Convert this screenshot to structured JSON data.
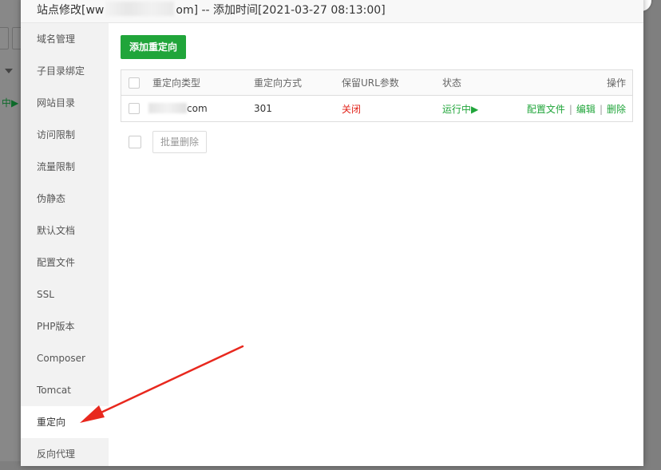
{
  "modal": {
    "title_prefix": "站点修改[ww",
    "title_suffix": "om] -- 添加时间[2021-03-27 08:13:00]"
  },
  "background": {
    "status_text": "中▶"
  },
  "sidebar": {
    "items": [
      {
        "label": "域名管理"
      },
      {
        "label": "子目录绑定"
      },
      {
        "label": "网站目录"
      },
      {
        "label": "访问限制"
      },
      {
        "label": "流量限制"
      },
      {
        "label": "伪静态"
      },
      {
        "label": "默认文档"
      },
      {
        "label": "配置文件"
      },
      {
        "label": "SSL"
      },
      {
        "label": "PHP版本"
      },
      {
        "label": "Composer"
      },
      {
        "label": "Tomcat"
      },
      {
        "label": "重定向"
      },
      {
        "label": "反向代理"
      }
    ],
    "active_index": 12
  },
  "toolbar": {
    "add_label": "添加重定向"
  },
  "table": {
    "headers": {
      "type": "重定向类型",
      "mode": "重定向方式",
      "keep": "保留URL参数",
      "status": "状态",
      "ops": "操作"
    },
    "rows": [
      {
        "domain_suffix": "com",
        "mode": "301",
        "keep": "关闭",
        "status": "运行中▶",
        "op_config": "配置文件",
        "op_edit": "编辑",
        "op_delete": "删除"
      }
    ]
  },
  "batch": {
    "delete_label": "批量删除"
  },
  "colors": {
    "accent": "#20a53a",
    "danger": "#e2231a",
    "arrow": "#e8281e"
  }
}
